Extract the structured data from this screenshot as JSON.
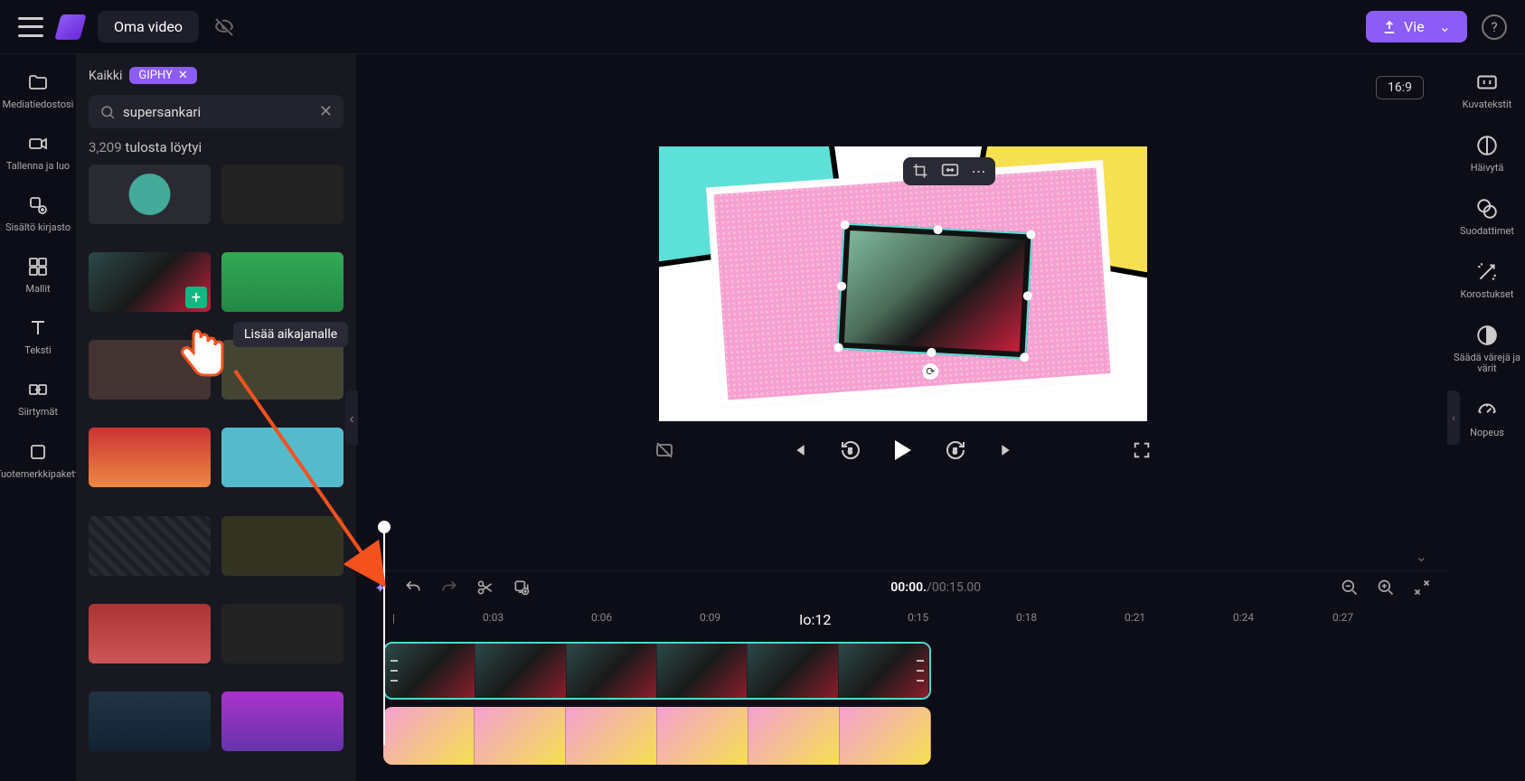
{
  "topbar": {
    "title": "Oma video",
    "export_label": "Vie"
  },
  "leftbar": {
    "media": "Mediatiedostosi",
    "record": "Tallenna ja luo",
    "library": "Sisältö kirjasto",
    "templates": "Mallit",
    "text": "Teksti",
    "transitions": "Siirtymät",
    "brandkit": "Tuotemerkkipaketti"
  },
  "panel": {
    "filter_all": "Kaikki",
    "chip_label": "GIPHY",
    "search_value": "supersankari",
    "results_count": "3,209",
    "results_label": "tulosta löytyi",
    "tooltip_add": "Lisää aikajanalle"
  },
  "preview": {
    "aspect": "16:9"
  },
  "timeline": {
    "current": "00:00.",
    "total": "/00:15.00",
    "ruler_highlight": "Io:12",
    "ticks": [
      "0:03",
      "0:06",
      "0:09",
      "",
      "0:15",
      "0:18",
      "0:21",
      "0:24",
      "0:27"
    ]
  },
  "rightbar": {
    "captions": "Kuvatekstit",
    "fade": "Häivytä",
    "filters": "Suodattimet",
    "highlights": "Korostukset",
    "colors": "Säädä värejä ja värit",
    "speed": "Nopeus"
  }
}
